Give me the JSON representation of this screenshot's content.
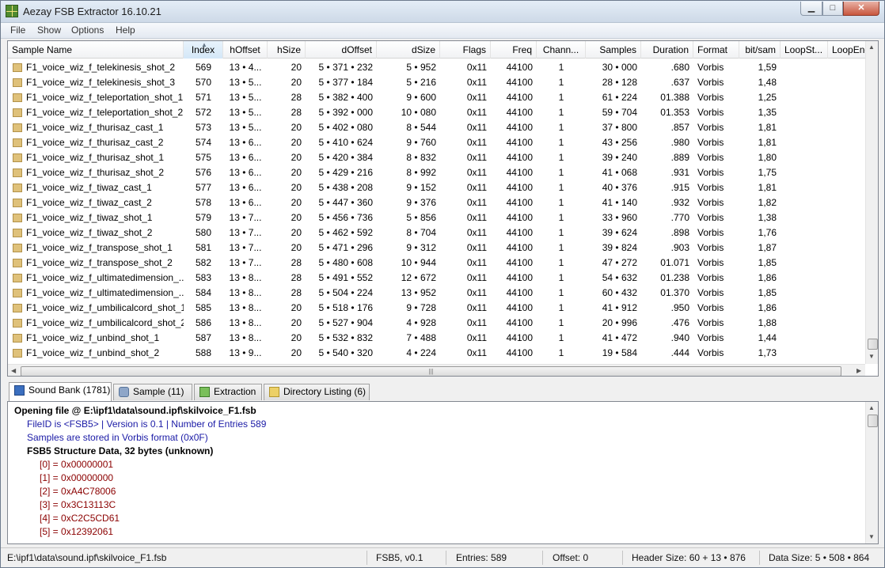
{
  "window": {
    "title": "Aezay FSB Extractor 16.10.21"
  },
  "menu": [
    "File",
    "Show",
    "Options",
    "Help"
  ],
  "grid": {
    "columns": [
      "Sample Name",
      "Index",
      "hOffset",
      "hSize",
      "dOffset",
      "dSize",
      "Flags",
      "Freq",
      "Chann...",
      "Samples",
      "Duration",
      "Format",
      "bit/sam",
      "LoopSt...",
      "LoopEnd"
    ],
    "rows": [
      [
        "F1_voice_wiz_f_telekinesis_shot_2",
        "569",
        "13 • 4...",
        "20",
        "5 • 371 • 232",
        "5 • 952",
        "0x11",
        "44100",
        "1",
        "30 • 000",
        ".680",
        "Vorbis",
        "1,59"
      ],
      [
        "F1_voice_wiz_f_telekinesis_shot_3",
        "570",
        "13 • 5...",
        "20",
        "5 • 377 • 184",
        "5 • 216",
        "0x11",
        "44100",
        "1",
        "28 • 128",
        ".637",
        "Vorbis",
        "1,48"
      ],
      [
        "F1_voice_wiz_f_teleportation_shot_1",
        "571",
        "13 • 5...",
        "28",
        "5 • 382 • 400",
        "9 • 600",
        "0x11",
        "44100",
        "1",
        "61 • 224",
        "01.388",
        "Vorbis",
        "1,25"
      ],
      [
        "F1_voice_wiz_f_teleportation_shot_2",
        "572",
        "13 • 5...",
        "28",
        "5 • 392 • 000",
        "10 • 080",
        "0x11",
        "44100",
        "1",
        "59 • 704",
        "01.353",
        "Vorbis",
        "1,35"
      ],
      [
        "F1_voice_wiz_f_thurisaz_cast_1",
        "573",
        "13 • 5...",
        "20",
        "5 • 402 • 080",
        "8 • 544",
        "0x11",
        "44100",
        "1",
        "37 • 800",
        ".857",
        "Vorbis",
        "1,81"
      ],
      [
        "F1_voice_wiz_f_thurisaz_cast_2",
        "574",
        "13 • 6...",
        "20",
        "5 • 410 • 624",
        "9 • 760",
        "0x11",
        "44100",
        "1",
        "43 • 256",
        ".980",
        "Vorbis",
        "1,81"
      ],
      [
        "F1_voice_wiz_f_thurisaz_shot_1",
        "575",
        "13 • 6...",
        "20",
        "5 • 420 • 384",
        "8 • 832",
        "0x11",
        "44100",
        "1",
        "39 • 240",
        ".889",
        "Vorbis",
        "1,80"
      ],
      [
        "F1_voice_wiz_f_thurisaz_shot_2",
        "576",
        "13 • 6...",
        "20",
        "5 • 429 • 216",
        "8 • 992",
        "0x11",
        "44100",
        "1",
        "41 • 068",
        ".931",
        "Vorbis",
        "1,75"
      ],
      [
        "F1_voice_wiz_f_tiwaz_cast_1",
        "577",
        "13 • 6...",
        "20",
        "5 • 438 • 208",
        "9 • 152",
        "0x11",
        "44100",
        "1",
        "40 • 376",
        ".915",
        "Vorbis",
        "1,81"
      ],
      [
        "F1_voice_wiz_f_tiwaz_cast_2",
        "578",
        "13 • 6...",
        "20",
        "5 • 447 • 360",
        "9 • 376",
        "0x11",
        "44100",
        "1",
        "41 • 140",
        ".932",
        "Vorbis",
        "1,82"
      ],
      [
        "F1_voice_wiz_f_tiwaz_shot_1",
        "579",
        "13 • 7...",
        "20",
        "5 • 456 • 736",
        "5 • 856",
        "0x11",
        "44100",
        "1",
        "33 • 960",
        ".770",
        "Vorbis",
        "1,38"
      ],
      [
        "F1_voice_wiz_f_tiwaz_shot_2",
        "580",
        "13 • 7...",
        "20",
        "5 • 462 • 592",
        "8 • 704",
        "0x11",
        "44100",
        "1",
        "39 • 624",
        ".898",
        "Vorbis",
        "1,76"
      ],
      [
        "F1_voice_wiz_f_transpose_shot_1",
        "581",
        "13 • 7...",
        "20",
        "5 • 471 • 296",
        "9 • 312",
        "0x11",
        "44100",
        "1",
        "39 • 824",
        ".903",
        "Vorbis",
        "1,87"
      ],
      [
        "F1_voice_wiz_f_transpose_shot_2",
        "582",
        "13 • 7...",
        "28",
        "5 • 480 • 608",
        "10 • 944",
        "0x11",
        "44100",
        "1",
        "47 • 272",
        "01.071",
        "Vorbis",
        "1,85"
      ],
      [
        "F1_voice_wiz_f_ultimatedimension_...",
        "583",
        "13 • 8...",
        "28",
        "5 • 491 • 552",
        "12 • 672",
        "0x11",
        "44100",
        "1",
        "54 • 632",
        "01.238",
        "Vorbis",
        "1,86"
      ],
      [
        "F1_voice_wiz_f_ultimatedimension_...",
        "584",
        "13 • 8...",
        "28",
        "5 • 504 • 224",
        "13 • 952",
        "0x11",
        "44100",
        "1",
        "60 • 432",
        "01.370",
        "Vorbis",
        "1,85"
      ],
      [
        "F1_voice_wiz_f_umbilicalcord_shot_1",
        "585",
        "13 • 8...",
        "20",
        "5 • 518 • 176",
        "9 • 728",
        "0x11",
        "44100",
        "1",
        "41 • 912",
        ".950",
        "Vorbis",
        "1,86"
      ],
      [
        "F1_voice_wiz_f_umbilicalcord_shot_2",
        "586",
        "13 • 8...",
        "20",
        "5 • 527 • 904",
        "4 • 928",
        "0x11",
        "44100",
        "1",
        "20 • 996",
        ".476",
        "Vorbis",
        "1,88"
      ],
      [
        "F1_voice_wiz_f_unbind_shot_1",
        "587",
        "13 • 8...",
        "20",
        "5 • 532 • 832",
        "7 • 488",
        "0x11",
        "44100",
        "1",
        "41 • 472",
        ".940",
        "Vorbis",
        "1,44"
      ],
      [
        "F1_voice_wiz_f_unbind_shot_2",
        "588",
        "13 • 9...",
        "20",
        "5 • 540 • 320",
        "4 • 224",
        "0x11",
        "44100",
        "1",
        "19 • 584",
        ".444",
        "Vorbis",
        "1,73"
      ]
    ]
  },
  "tabs": [
    {
      "label": "Sound Bank (1781)",
      "icon": "sound-bank-icon",
      "active": true
    },
    {
      "label": "Sample (11)",
      "icon": "speaker-icon",
      "active": false
    },
    {
      "label": "Extraction",
      "icon": "extract-arrow-icon",
      "active": false
    },
    {
      "label": "Directory Listing (6)",
      "icon": "folder-icon",
      "active": false
    }
  ],
  "log": [
    {
      "level": 0,
      "text": "Opening file  @  E:\\ipf1\\data\\sound.ipf\\skilvoice_F1.fsb"
    },
    {
      "level": 1,
      "text": "FileID is <FSB5>  |  Version is 0.1  |  Number of Entries 589"
    },
    {
      "level": 1,
      "text": "Samples are stored in Vorbis format (0x0F)"
    },
    {
      "level": 3,
      "text": "FSB5 Structure Data, 32 bytes (unknown)"
    },
    {
      "level": 2,
      "text": "[0]  = 0x00000001"
    },
    {
      "level": 2,
      "text": "[1]  = 0x00000000"
    },
    {
      "level": 2,
      "text": "[2]  = 0xA4C78006"
    },
    {
      "level": 2,
      "text": "[3]  = 0x3C13113C"
    },
    {
      "level": 2,
      "text": "[4]  = 0xC2C5CD61"
    },
    {
      "level": 2,
      "text": "[5]  = 0x12392061"
    }
  ],
  "status": {
    "path": "E:\\ipf1\\data\\sound.ipf\\skilvoice_F1.fsb",
    "format": "FSB5, v0.1",
    "entries": "Entries: 589",
    "offset": "Offset: 0",
    "header_size": "Header Size: 60 + 13 • 876",
    "data_size": "Data Size: 5 • 508 • 864"
  }
}
